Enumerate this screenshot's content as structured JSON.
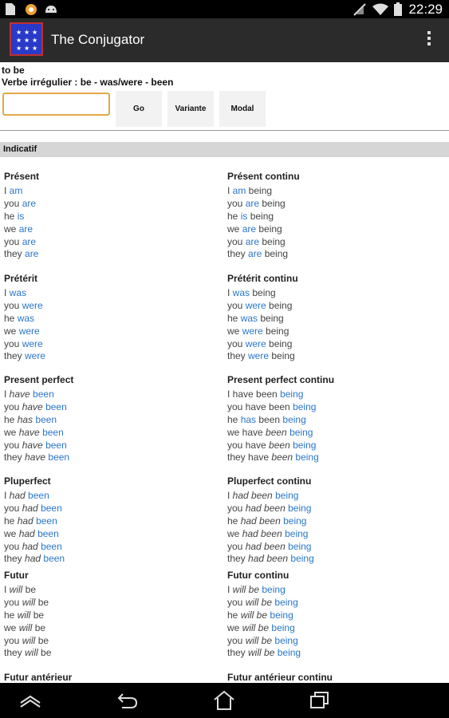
{
  "status": {
    "time": "22:29"
  },
  "app": {
    "title": "The Conjugator"
  },
  "verb": {
    "name": "to be",
    "info": "Verbe irrégulier : be - was/were - been"
  },
  "input": {
    "value": "",
    "placeholder": ""
  },
  "buttons": {
    "go": "Go",
    "variante": "Variante",
    "modal": "Modal"
  },
  "section_title": "Indicatif",
  "tenses": [
    {
      "title": "Présent",
      "lines": [
        [
          [
            "p",
            "I "
          ],
          [
            "v",
            "am"
          ]
        ],
        [
          [
            "p",
            "you "
          ],
          [
            "v",
            "are"
          ]
        ],
        [
          [
            "p",
            "he "
          ],
          [
            "v",
            "is"
          ]
        ],
        [
          [
            "p",
            "we "
          ],
          [
            "v",
            "are"
          ]
        ],
        [
          [
            "p",
            "you "
          ],
          [
            "v",
            "are"
          ]
        ],
        [
          [
            "p",
            "they "
          ],
          [
            "v",
            "are"
          ]
        ]
      ]
    },
    {
      "title": "Présent continu",
      "lines": [
        [
          [
            "p",
            "I "
          ],
          [
            "v",
            "am"
          ],
          [
            "p",
            " being"
          ]
        ],
        [
          [
            "p",
            "you "
          ],
          [
            "v",
            "are"
          ],
          [
            "p",
            " being"
          ]
        ],
        [
          [
            "p",
            "he "
          ],
          [
            "v",
            "is"
          ],
          [
            "p",
            " being"
          ]
        ],
        [
          [
            "p",
            "we "
          ],
          [
            "v",
            "are"
          ],
          [
            "p",
            " being"
          ]
        ],
        [
          [
            "p",
            "you "
          ],
          [
            "v",
            "are"
          ],
          [
            "p",
            " being"
          ]
        ],
        [
          [
            "p",
            "they "
          ],
          [
            "v",
            "are"
          ],
          [
            "p",
            " being"
          ]
        ]
      ]
    },
    {
      "title": "Prétérit",
      "lines": [
        [
          [
            "p",
            "I "
          ],
          [
            "v",
            "was"
          ]
        ],
        [
          [
            "p",
            "you "
          ],
          [
            "v",
            "were"
          ]
        ],
        [
          [
            "p",
            "he "
          ],
          [
            "v",
            "was"
          ]
        ],
        [
          [
            "p",
            "we "
          ],
          [
            "v",
            "were"
          ]
        ],
        [
          [
            "p",
            "you "
          ],
          [
            "v",
            "were"
          ]
        ],
        [
          [
            "p",
            "they "
          ],
          [
            "v",
            "were"
          ]
        ]
      ]
    },
    {
      "title": "Prétérit continu",
      "lines": [
        [
          [
            "p",
            "I "
          ],
          [
            "v",
            "was"
          ],
          [
            "p",
            " being"
          ]
        ],
        [
          [
            "p",
            "you "
          ],
          [
            "v",
            "were"
          ],
          [
            "p",
            " being"
          ]
        ],
        [
          [
            "p",
            "he "
          ],
          [
            "v",
            "was"
          ],
          [
            "p",
            " being"
          ]
        ],
        [
          [
            "p",
            "we "
          ],
          [
            "v",
            "were"
          ],
          [
            "p",
            " being"
          ]
        ],
        [
          [
            "p",
            "you "
          ],
          [
            "v",
            "were"
          ],
          [
            "p",
            " being"
          ]
        ],
        [
          [
            "p",
            "they "
          ],
          [
            "v",
            "were"
          ],
          [
            "p",
            " being"
          ]
        ]
      ]
    },
    {
      "title": "Present perfect",
      "lines": [
        [
          [
            "p",
            "I "
          ],
          [
            "a",
            "have"
          ],
          [
            "p",
            " "
          ],
          [
            "v",
            "been"
          ]
        ],
        [
          [
            "p",
            "you "
          ],
          [
            "a",
            "have"
          ],
          [
            "p",
            " "
          ],
          [
            "v",
            "been"
          ]
        ],
        [
          [
            "p",
            "he "
          ],
          [
            "a",
            "has"
          ],
          [
            "p",
            " "
          ],
          [
            "v",
            "been"
          ]
        ],
        [
          [
            "p",
            "we "
          ],
          [
            "a",
            "have"
          ],
          [
            "p",
            " "
          ],
          [
            "v",
            "been"
          ]
        ],
        [
          [
            "p",
            "you "
          ],
          [
            "a",
            "have"
          ],
          [
            "p",
            " "
          ],
          [
            "v",
            "been"
          ]
        ],
        [
          [
            "p",
            "they "
          ],
          [
            "a",
            "have"
          ],
          [
            "p",
            " "
          ],
          [
            "v",
            "been"
          ]
        ]
      ]
    },
    {
      "title": "Present perfect continu",
      "lines": [
        [
          [
            "p",
            "I have been "
          ],
          [
            "v",
            "being"
          ]
        ],
        [
          [
            "p",
            "you have been "
          ],
          [
            "v",
            "being"
          ]
        ],
        [
          [
            "p",
            "he "
          ],
          [
            "v",
            "has"
          ],
          [
            "p",
            " been "
          ],
          [
            "v",
            "being"
          ]
        ],
        [
          [
            "p",
            "we have "
          ],
          [
            "a",
            "been"
          ],
          [
            "p",
            " "
          ],
          [
            "v",
            "being"
          ]
        ],
        [
          [
            "p",
            "you have "
          ],
          [
            "a",
            "been"
          ],
          [
            "p",
            " "
          ],
          [
            "v",
            "being"
          ]
        ],
        [
          [
            "p",
            "they have "
          ],
          [
            "a",
            "been"
          ],
          [
            "p",
            " "
          ],
          [
            "v",
            "being"
          ]
        ]
      ]
    },
    {
      "title": "Pluperfect",
      "lines": [
        [
          [
            "p",
            "I "
          ],
          [
            "a",
            "had"
          ],
          [
            "p",
            " "
          ],
          [
            "v",
            "been"
          ]
        ],
        [
          [
            "p",
            "you "
          ],
          [
            "a",
            "had"
          ],
          [
            "p",
            " "
          ],
          [
            "v",
            "been"
          ]
        ],
        [
          [
            "p",
            "he "
          ],
          [
            "a",
            "had"
          ],
          [
            "p",
            " "
          ],
          [
            "v",
            "been"
          ]
        ],
        [
          [
            "p",
            "we "
          ],
          [
            "a",
            "had"
          ],
          [
            "p",
            " "
          ],
          [
            "v",
            "been"
          ]
        ],
        [
          [
            "p",
            "you "
          ],
          [
            "a",
            "had"
          ],
          [
            "p",
            " "
          ],
          [
            "v",
            "been"
          ]
        ],
        [
          [
            "p",
            "they "
          ],
          [
            "a",
            "had"
          ],
          [
            "p",
            " "
          ],
          [
            "v",
            "been"
          ]
        ]
      ]
    },
    {
      "title": "Pluperfect continu",
      "lines": [
        [
          [
            "p",
            "I "
          ],
          [
            "a",
            "had been"
          ],
          [
            "p",
            " "
          ],
          [
            "v",
            "being"
          ]
        ],
        [
          [
            "p",
            "you "
          ],
          [
            "a",
            "had been"
          ],
          [
            "p",
            " "
          ],
          [
            "v",
            "being"
          ]
        ],
        [
          [
            "p",
            "he "
          ],
          [
            "a",
            "had been"
          ],
          [
            "p",
            " "
          ],
          [
            "v",
            "being"
          ]
        ],
        [
          [
            "p",
            "we "
          ],
          [
            "a",
            "had been"
          ],
          [
            "p",
            " "
          ],
          [
            "v",
            "being"
          ]
        ],
        [
          [
            "p",
            "you "
          ],
          [
            "a",
            "had been"
          ],
          [
            "p",
            " "
          ],
          [
            "v",
            "being"
          ]
        ],
        [
          [
            "p",
            "they "
          ],
          [
            "a",
            "had been"
          ],
          [
            "p",
            " "
          ],
          [
            "v",
            "being"
          ]
        ]
      ]
    },
    {
      "title": "Futur",
      "lines": [
        [
          [
            "p",
            "I "
          ],
          [
            "a",
            "will"
          ],
          [
            "p",
            " be"
          ]
        ],
        [
          [
            "p",
            "you "
          ],
          [
            "a",
            "will"
          ],
          [
            "p",
            " be"
          ]
        ],
        [
          [
            "p",
            "he "
          ],
          [
            "a",
            "will"
          ],
          [
            "p",
            " be"
          ]
        ],
        [
          [
            "p",
            "we "
          ],
          [
            "a",
            "will"
          ],
          [
            "p",
            " be"
          ]
        ],
        [
          [
            "p",
            "you "
          ],
          [
            "a",
            "will"
          ],
          [
            "p",
            " be"
          ]
        ],
        [
          [
            "p",
            "they "
          ],
          [
            "a",
            "will"
          ],
          [
            "p",
            " be"
          ]
        ]
      ]
    },
    {
      "title": "Futur continu",
      "lines": [
        [
          [
            "p",
            "I "
          ],
          [
            "a",
            "will be"
          ],
          [
            "p",
            " "
          ],
          [
            "v",
            "being"
          ]
        ],
        [
          [
            "p",
            "you "
          ],
          [
            "a",
            "will be"
          ],
          [
            "p",
            " "
          ],
          [
            "v",
            "being"
          ]
        ],
        [
          [
            "p",
            "he "
          ],
          [
            "a",
            "will be"
          ],
          [
            "p",
            " "
          ],
          [
            "v",
            "being"
          ]
        ],
        [
          [
            "p",
            "we "
          ],
          [
            "a",
            "will be"
          ],
          [
            "p",
            " "
          ],
          [
            "v",
            "being"
          ]
        ],
        [
          [
            "p",
            "you "
          ],
          [
            "a",
            "will be"
          ],
          [
            "p",
            " "
          ],
          [
            "v",
            "being"
          ]
        ],
        [
          [
            "p",
            "they "
          ],
          [
            "a",
            "will be"
          ],
          [
            "p",
            " "
          ],
          [
            "v",
            "being"
          ]
        ]
      ]
    },
    {
      "title": "Futur antérieur",
      "lines": []
    },
    {
      "title": "Futur antérieur continu",
      "lines": []
    }
  ],
  "colors": {
    "verb": "#2a77c9",
    "actionbar": "#2b2b2b",
    "section": "#d6d6d6",
    "input_border": "#e2a944"
  },
  "icons": {
    "status_left": [
      "document-icon",
      "notification-icon",
      "android-icon"
    ],
    "status_right": [
      "no-sim-icon",
      "wifi-icon",
      "battery-icon"
    ],
    "nav": [
      "home-icon",
      "back-icon",
      "house-icon",
      "recents-icon"
    ]
  }
}
